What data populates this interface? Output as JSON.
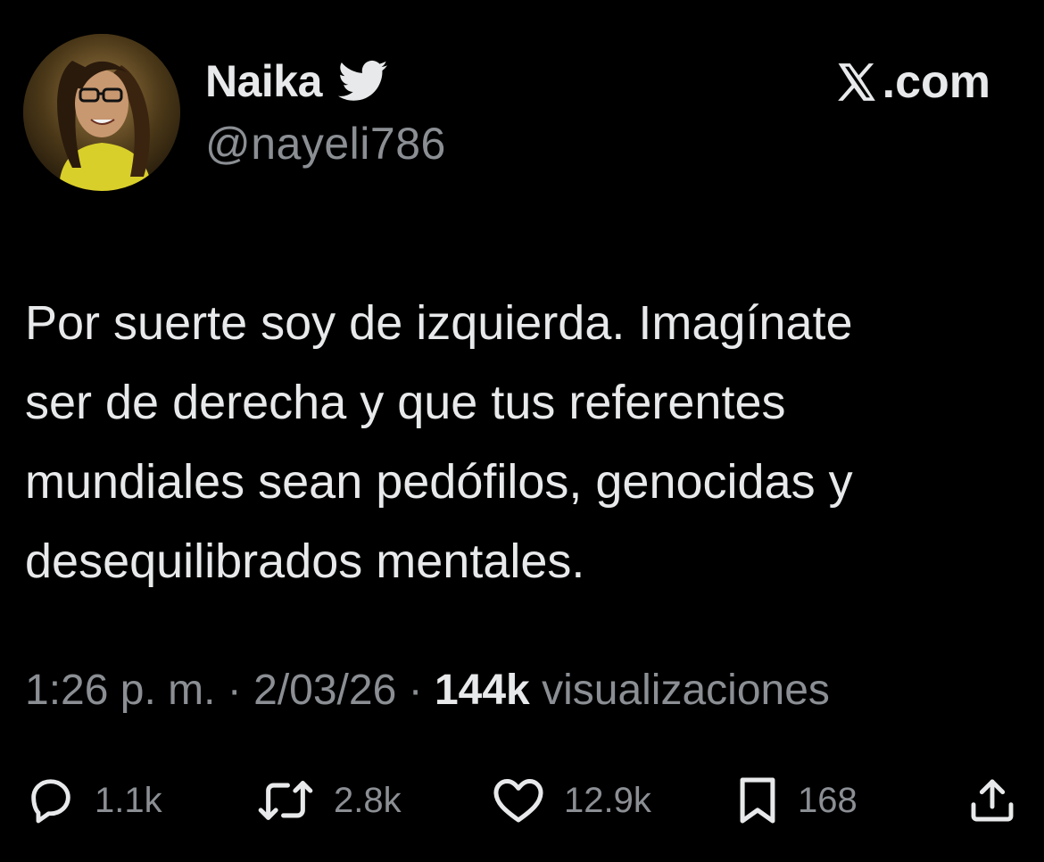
{
  "user": {
    "display_name": "Naika",
    "handle": "@nayeli786"
  },
  "brand": {
    "name": ".com"
  },
  "tweet": {
    "text": "Por suerte soy de izquierda. Imagínate\nser de derecha y que tus referentes\nmundiales sean pedófilos, genocidas y\ndesequilibrados mentales."
  },
  "meta": {
    "time": "1:26 p. m.",
    "separator": "·",
    "date": "2/03/26",
    "views_count": "144k",
    "views_label": "visualizaciones"
  },
  "actions": {
    "replies": "1.1k",
    "retweets": "2.8k",
    "likes": "12.9k",
    "bookmarks": "168"
  },
  "icons": {
    "verified": "twitter-bird-icon",
    "brand": "x-logo-icon",
    "reply": "reply-icon",
    "retweet": "retweet-icon",
    "like": "heart-icon",
    "bookmark": "bookmark-icon",
    "share": "share-icon"
  },
  "colors": {
    "background": "#000000",
    "primary_text": "#e7e9ea",
    "secondary_text": "#8b8f94"
  }
}
